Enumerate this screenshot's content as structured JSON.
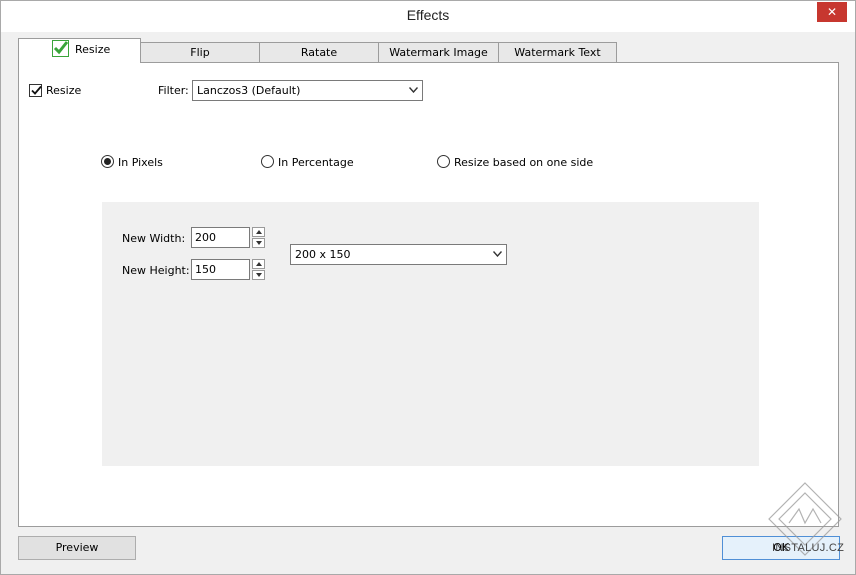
{
  "window": {
    "title": "Effects",
    "close_glyph": "✕"
  },
  "tabs": [
    {
      "label": "Resize",
      "icon": "check-icon",
      "active": true
    },
    {
      "label": "Flip"
    },
    {
      "label": "Ratate"
    },
    {
      "label": "Watermark Image"
    },
    {
      "label": "Watermark Text"
    }
  ],
  "resize": {
    "enabled_label": "Resize",
    "enabled_checked": true,
    "filter_label": "Filter:",
    "filter_value": "Lanczos3 (Default)"
  },
  "mode": {
    "options": [
      "In Pixels",
      "In Percentage",
      "Resize based on one side"
    ],
    "selected": "In Pixels"
  },
  "pixels": {
    "width_label": "New Width:",
    "width_value": "200",
    "height_label": "New Height:",
    "height_value": "150",
    "preset_value": "200 x 150"
  },
  "footer": {
    "preview_label": "Preview",
    "ok_label": "OK"
  },
  "watermark_text": "INSTALUJ.CZ",
  "colors": {
    "accent": "#4f8fd6",
    "close": "#c7372f",
    "check": "#3aa43a"
  }
}
